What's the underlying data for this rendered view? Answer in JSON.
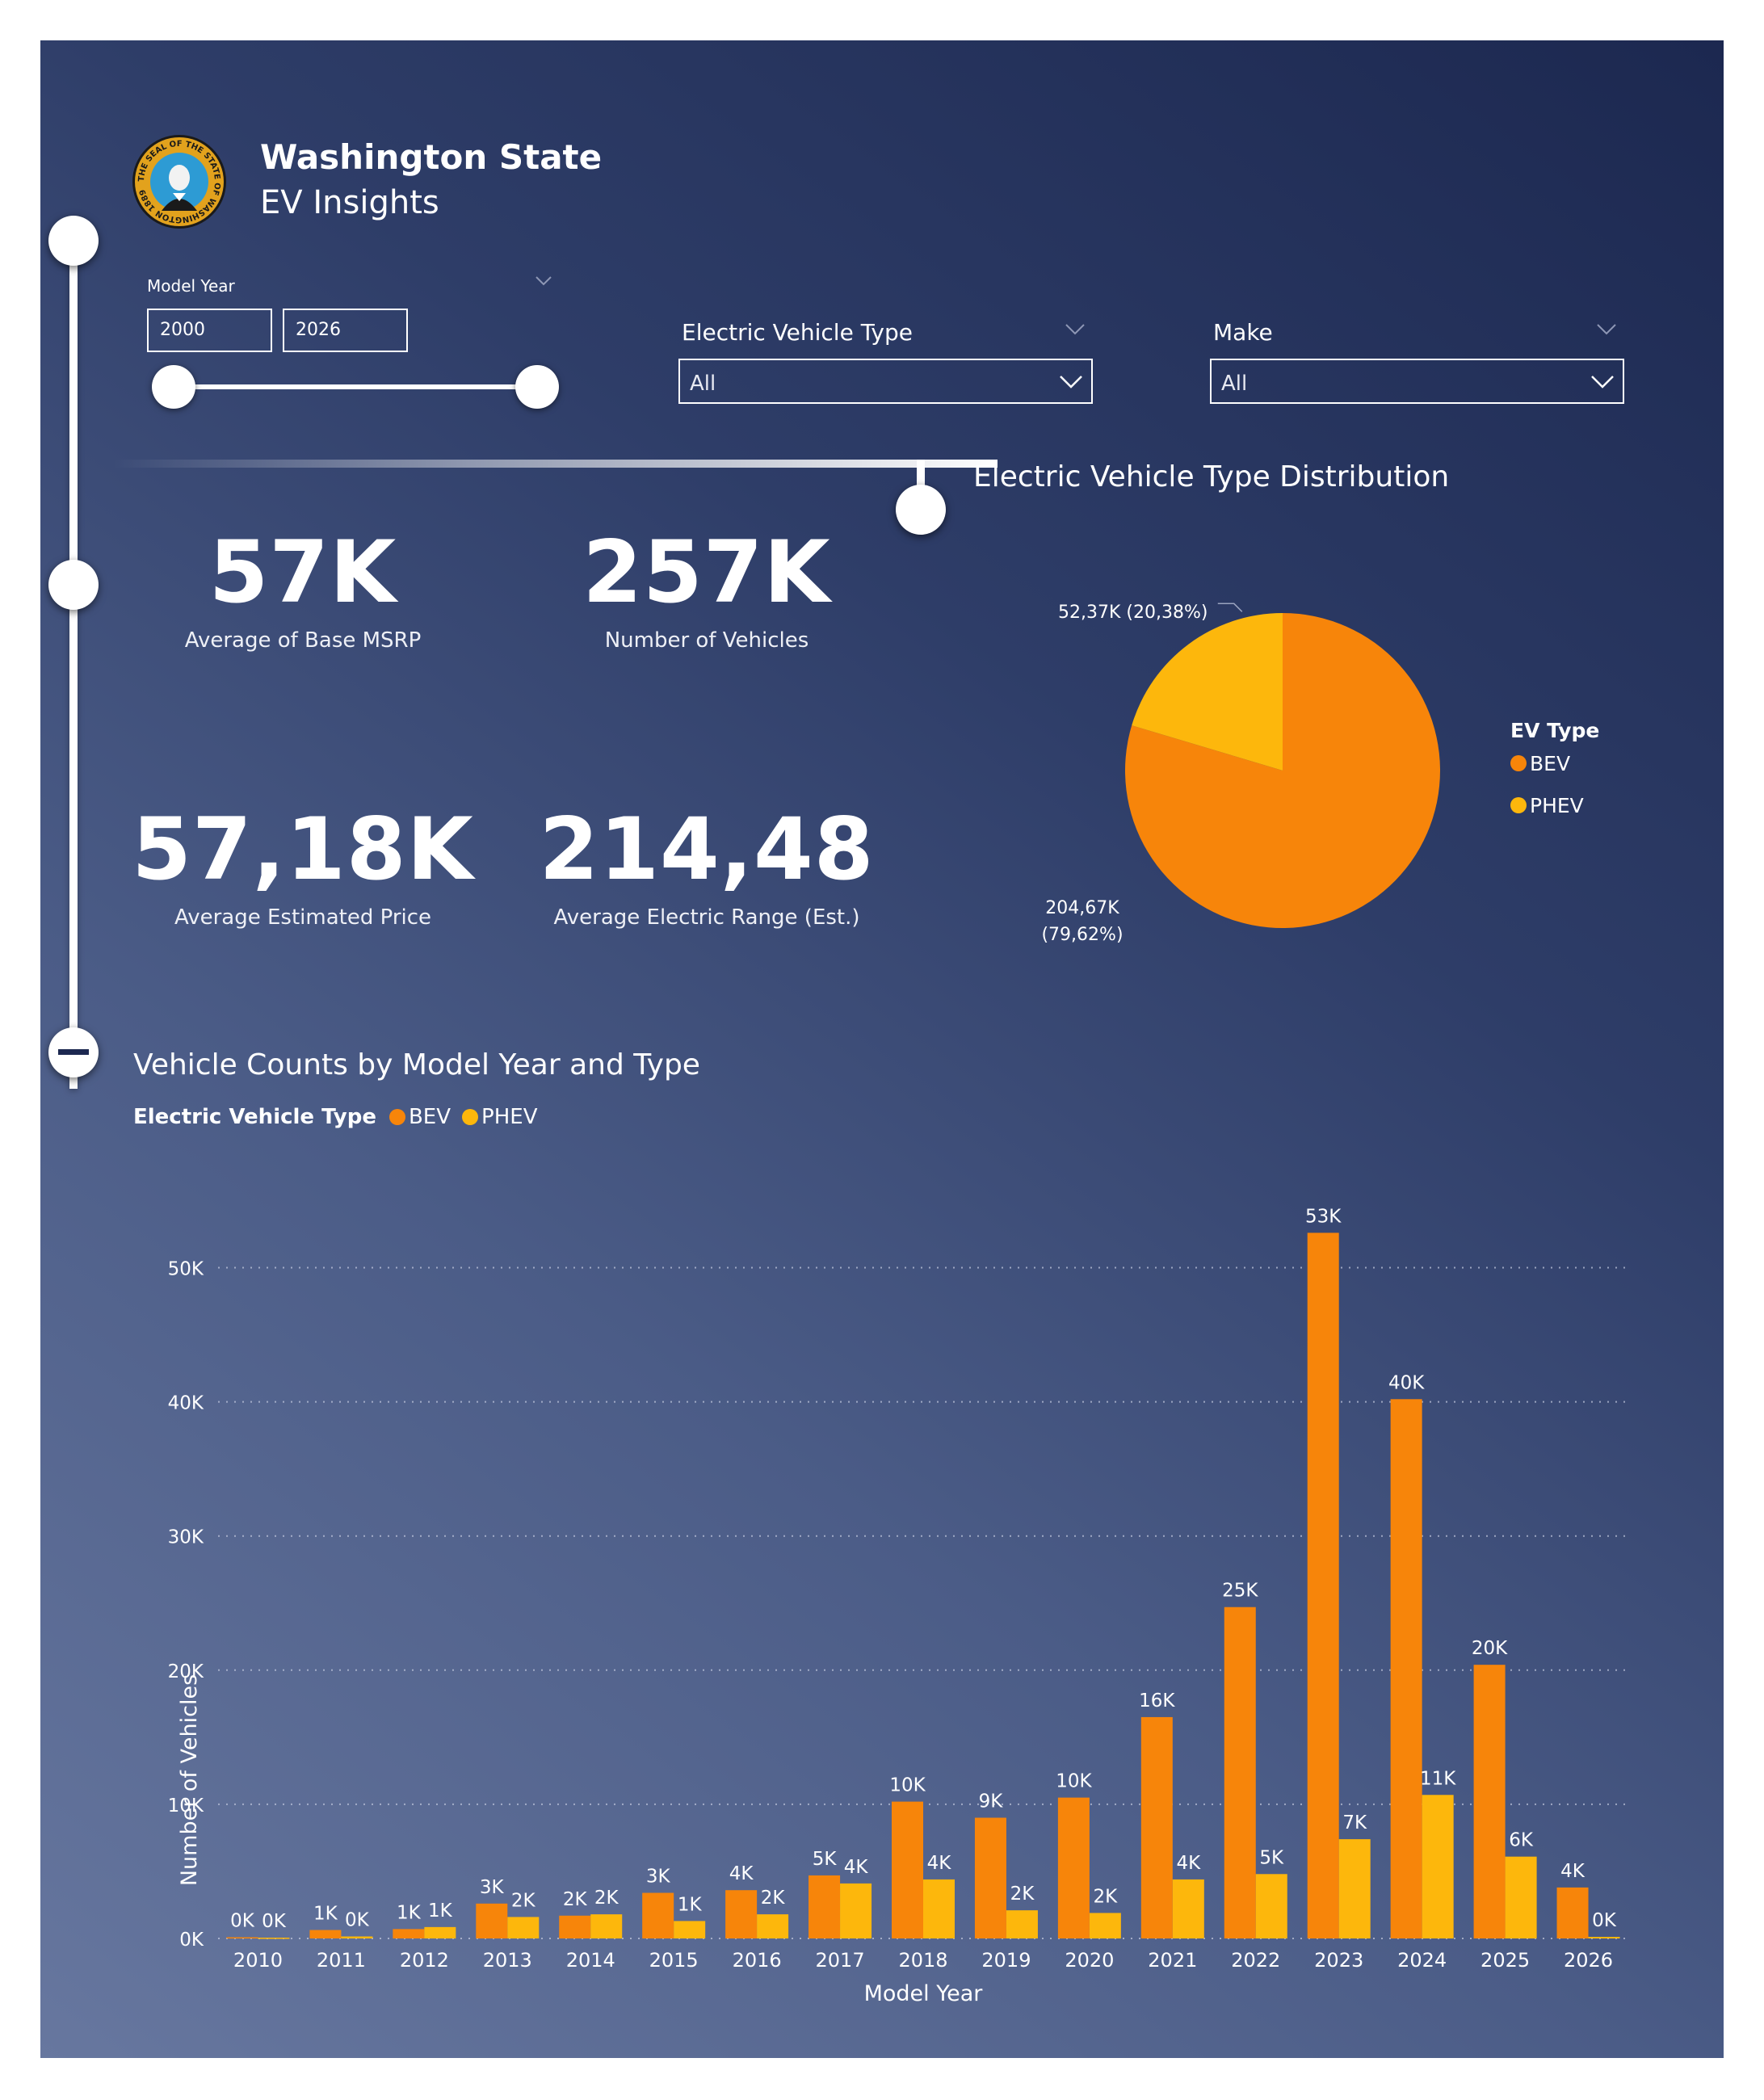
{
  "header": {
    "title": "Washington State",
    "subtitle": "EV Insights",
    "seal_text": "THE SEAL OF THE STATE OF WASHINGTON 1889"
  },
  "filters": {
    "model_year": {
      "label": "Model Year",
      "from": "2000",
      "to": "2026",
      "range_fraction": [
        0.0,
        1.0
      ]
    },
    "ev_type": {
      "label": "Electric Vehicle Type",
      "value": "All"
    },
    "make": {
      "label": "Make",
      "value": "All"
    }
  },
  "kpis": [
    {
      "value": "57K",
      "label": "Average of Base MSRP"
    },
    {
      "value": "257K",
      "label": "Number of Vehicles"
    },
    {
      "value": "57,18K",
      "label": "Average Estimated Price"
    },
    {
      "value": "214,48",
      "label": "Average Electric Range  (Est.)"
    }
  ],
  "colors": {
    "bev": "#f7850a",
    "phev": "#fdb70c",
    "background_dark": "#1c2850",
    "background_light": "#67779f"
  },
  "chart_data": [
    {
      "type": "pie",
      "title": "Electric Vehicle Type Distribution",
      "legend_title": "EV Type",
      "legend_position": "right",
      "slices": [
        {
          "name": "BEV",
          "value": 204670,
          "label": "204,67K (79,62%)",
          "label_line1": "204,67K",
          "label_line2": "(79,62%)",
          "percent": 79.62
        },
        {
          "name": "PHEV",
          "value": 52370,
          "label": "52,37K (20,38%)",
          "percent": 20.38
        }
      ]
    },
    {
      "type": "bar",
      "title": "Vehicle Counts by Model Year and Type",
      "legend_title": "Electric Vehicle Type",
      "legend_position": "top-left",
      "xlabel": "Model Year",
      "ylabel": "Number of Vehicles",
      "ylim": [
        0,
        52500
      ],
      "yticks": [
        0,
        10000,
        20000,
        30000,
        40000,
        50000
      ],
      "ytick_labels": [
        "0K",
        "10K",
        "20K",
        "30K",
        "40K",
        "50K"
      ],
      "grid": true,
      "categories": [
        "2010",
        "2011",
        "2012",
        "2013",
        "2014",
        "2015",
        "2016",
        "2017",
        "2018",
        "2019",
        "2020",
        "2021",
        "2022",
        "2023",
        "2024",
        "2025",
        "2026"
      ],
      "series": [
        {
          "name": "BEV",
          "values": [
            90,
            630,
            700,
            2600,
            1700,
            3400,
            3600,
            4700,
            10200,
            9000,
            10500,
            16500,
            24700,
            52600,
            40200,
            20400,
            3800
          ],
          "labels": [
            "0K",
            "1K",
            "1K",
            "3K",
            "2K",
            "3K",
            "4K",
            "5K",
            "10K",
            "9K",
            "10K",
            "16K",
            "25K",
            "53K",
            "40K",
            "20K",
            "4K"
          ]
        },
        {
          "name": "PHEV",
          "values": [
            60,
            150,
            850,
            1600,
            1800,
            1300,
            1800,
            4100,
            4400,
            2100,
            1900,
            4400,
            4800,
            7400,
            10700,
            6100,
            120
          ],
          "labels": [
            "0K",
            "0K",
            "1K",
            "2K",
            "2K",
            "1K",
            "2K",
            "4K",
            "4K",
            "2K",
            "2K",
            "4K",
            "5K",
            "7K",
            "11K",
            "6K",
            "0K"
          ]
        }
      ]
    }
  ]
}
